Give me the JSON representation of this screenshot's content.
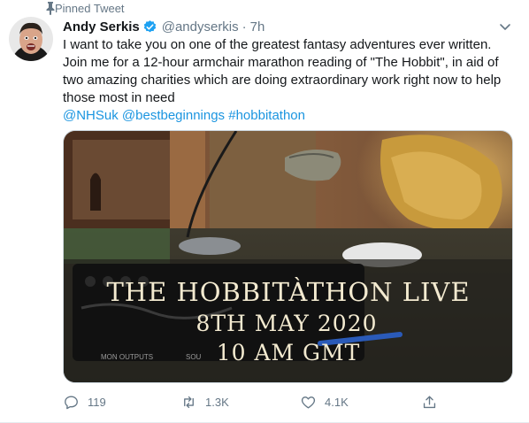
{
  "pinned": {
    "label": "Pinned Tweet"
  },
  "author": {
    "name": "Andy Serkis",
    "handle": "@andyserkis",
    "separator": "·",
    "time": "7h"
  },
  "tweet": {
    "text": "I want to take you on one of the greatest fantasy adventures ever written. Join me for a 12-hour armchair marathon reading of \"The Hobbit\", in aid of two amazing charities which are doing extraordinary work right now to help those most in need",
    "hashtags": [
      "@NHSuk",
      "@bestbeginnings",
      "#hobbitathon"
    ]
  },
  "media": {
    "title_line1": "THE HOBBITÀTHON LIVE",
    "title_line2": "8TH MAY 2020",
    "title_line3": "10 AM GMT",
    "device_label_1": "MON OUTPUTS",
    "device_label_2": "SOU"
  },
  "actions": {
    "replies": "119",
    "retweets": "1.3K",
    "likes": "4.1K"
  },
  "colors": {
    "link": "#1b95e0",
    "secondary_text": "#657786",
    "verified": "#1da1f2"
  },
  "icons": [
    "pin-icon",
    "verified-badge-icon",
    "caret-down-icon",
    "reply-icon",
    "retweet-icon",
    "like-icon",
    "share-icon"
  ]
}
